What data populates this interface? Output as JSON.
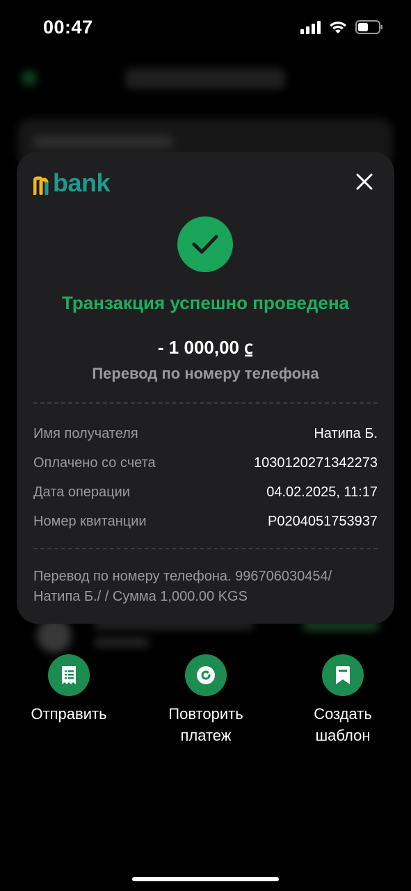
{
  "status_bar": {
    "time": "00:47",
    "icons": [
      "cellular-signal-icon",
      "wifi-icon",
      "battery-icon"
    ]
  },
  "modal": {
    "logo_text": "bank",
    "brand_colors": {
      "logo_yellow": "#f2b51c",
      "logo_teal": "#1e9b8d"
    },
    "close_icon": "close-icon",
    "success_icon": "check-circle-icon",
    "title": "Транзакция успешно проведена",
    "amount": "- 1 000,00 ⃀",
    "subtitle": "Перевод по номеру телефона",
    "details": [
      {
        "label": "Имя получателя",
        "value": "Натипа Б."
      },
      {
        "label": "Оплачено со счета",
        "value": "1030120271342273"
      },
      {
        "label": "Дата операции",
        "value": "04.02.2025, 11:17"
      },
      {
        "label": "Номер квитанции",
        "value": "P0204051753937"
      }
    ],
    "description_line1": "Перевод по номеру телефона. 996706030454/",
    "description_line2": "Натипа Б./  / Сумма 1,000.00 KGS"
  },
  "actions": [
    {
      "icon": "receipt-icon",
      "label_line1": "Отправить",
      "label_line2": ""
    },
    {
      "icon": "repeat-icon",
      "label_line1": "Повторить",
      "label_line2": "платеж"
    },
    {
      "icon": "bookmark-icon",
      "label_line1": "Создать",
      "label_line2": "шаблон"
    }
  ],
  "colors": {
    "success_green": "#1fae5c",
    "action_green": "#1c8c51",
    "card_bg": "#1f1f21"
  }
}
